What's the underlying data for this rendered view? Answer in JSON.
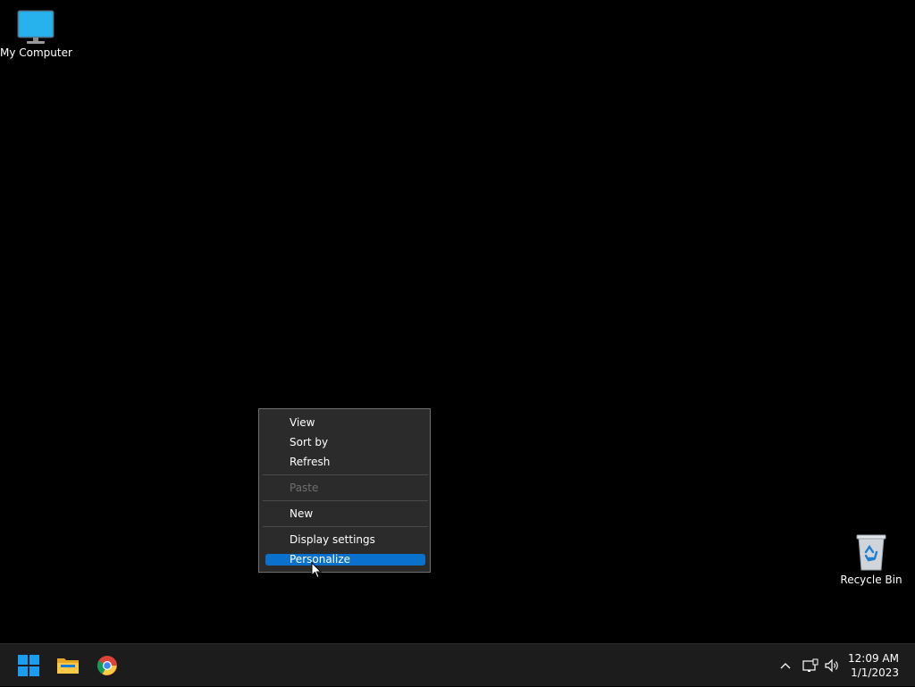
{
  "desktop": {
    "icons": [
      {
        "label": "My Computer",
        "icon": "monitor-icon"
      },
      {
        "label": "Recycle Bin",
        "icon": "recycle-bin-icon"
      }
    ]
  },
  "context_menu": {
    "items": [
      {
        "label": "View",
        "enabled": true
      },
      {
        "label": "Sort by",
        "enabled": true
      },
      {
        "label": "Refresh",
        "enabled": true
      },
      {
        "label": "Paste",
        "enabled": false
      },
      {
        "label": "New",
        "enabled": true
      },
      {
        "label": "Display settings",
        "enabled": true
      },
      {
        "label": "Personalize",
        "enabled": true,
        "highlighted": true
      }
    ],
    "highlight_color": "#0a72cd"
  },
  "taskbar": {
    "apps": [
      {
        "name": "start",
        "icon": "windows-start-icon"
      },
      {
        "name": "file-explorer",
        "icon": "folder-icon"
      },
      {
        "name": "chrome",
        "icon": "chrome-icon"
      }
    ],
    "tray": {
      "icons": [
        "chevron-up-icon",
        "network-icon",
        "volume-icon"
      ],
      "time": "12:09 AM",
      "date": "1/1/2023"
    }
  }
}
